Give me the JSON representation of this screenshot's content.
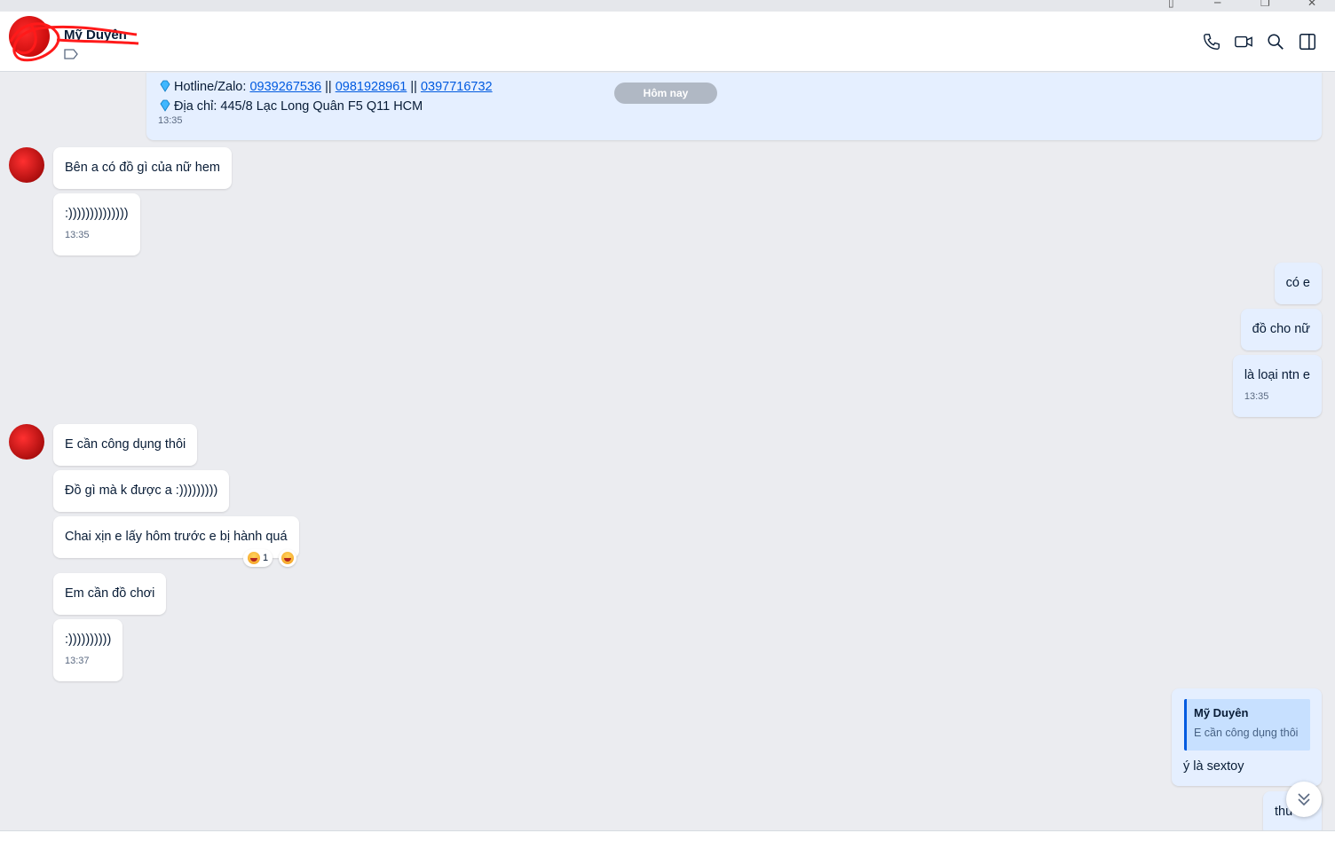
{
  "header": {
    "contact_name": "Mỹ Duyên",
    "icons": [
      "phone-icon",
      "video-call-icon",
      "search-icon",
      "side-panel-icon"
    ]
  },
  "chat": {
    "pinned_promo": {
      "line1_label": "Hotline/Zalo: ",
      "phone1": "0939267536",
      "sep1": " || ",
      "phone2": "0981928961",
      "sep2": " || ",
      "phone3": "0397716732",
      "line2": "Địa chỉ: 445/8 Lạc Long Quân F5 Q11 HCM",
      "time": "13:35"
    },
    "day_separator": "Hôm nay",
    "messages": [
      {
        "from": "contact",
        "text": "Bên a có đồ gì của nữ hem"
      },
      {
        "from": "contact",
        "text": ":))))))))))))))",
        "time": "13:35"
      },
      {
        "from": "me",
        "text": "có e"
      },
      {
        "from": "me",
        "text": "đồ cho nữ"
      },
      {
        "from": "me",
        "text": "là loại ntn e",
        "time": "13:35"
      },
      {
        "from": "contact",
        "text": "E cần công dụng thôi"
      },
      {
        "from": "contact",
        "text": "Đồ gì mà k được a :)))))))))"
      },
      {
        "from": "contact",
        "text": "Chai xịn e lấy hôm trước e bị hành quá",
        "reaction_count": "1"
      },
      {
        "from": "contact",
        "text": "Em cần đồ chơi"
      },
      {
        "from": "contact",
        "text": ":))))))))))",
        "time": "13:37"
      },
      {
        "from": "me",
        "quote_name": "Mỹ Duyên",
        "quote_text": "E cần công dụng thôi",
        "text": "ý là sextoy"
      },
      {
        "from": "me",
        "text": "thu"
      }
    ]
  },
  "colors": {
    "background": "#ebecf0",
    "my_bubble": "#e5efff",
    "their_bubble": "#ffffff",
    "link": "#005ae0",
    "day_pill": "#b0b8c4"
  }
}
